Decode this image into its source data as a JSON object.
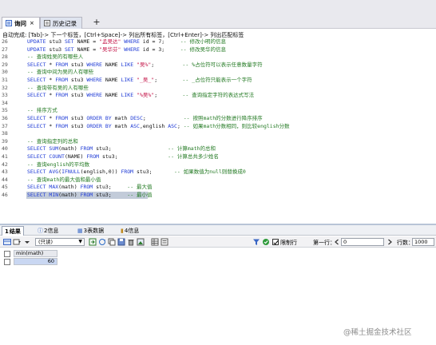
{
  "tabs": [
    {
      "label": "询问",
      "active": true
    },
    {
      "label": "历史记录",
      "active": false
    }
  ],
  "add_tab_label": "+",
  "autocomplete_hint": "自动完成: [Tab]-> 下一个标签，[Ctrl+Space]-> 列出所有标签，[Ctrl+Enter]-> 列出匹配标签",
  "editor_lines": [
    {
      "n": "26",
      "tokens": [
        [
          "kw",
          "UPDATE "
        ],
        [
          "plain",
          "stu3 "
        ],
        [
          "kw",
          "SET "
        ],
        [
          "plain",
          "NAME = "
        ],
        [
          "str",
          "\"孟吴达\""
        ],
        [
          "plain",
          " "
        ],
        [
          "kw",
          "WHERE "
        ],
        [
          "plain",
          "id = 7;     "
        ],
        [
          "com",
          "-- 修改小明的信息"
        ]
      ]
    },
    {
      "n": "27",
      "tokens": [
        [
          "kw",
          "UPDATE "
        ],
        [
          "plain",
          "stu3 "
        ],
        [
          "kw",
          "SET "
        ],
        [
          "plain",
          "NAME = "
        ],
        [
          "str",
          "\"吴华芬\""
        ],
        [
          "plain",
          " "
        ],
        [
          "kw",
          "WHERE "
        ],
        [
          "plain",
          "id = 3;     "
        ],
        [
          "com",
          "-- 修改吴华的信息"
        ]
      ]
    },
    {
      "n": "28",
      "tokens": [
        [
          "com",
          "-- 查询姓吴的有哪些人"
        ]
      ]
    },
    {
      "n": "29",
      "tokens": [
        [
          "kw",
          "SELECT "
        ],
        [
          "plain",
          "* "
        ],
        [
          "kw",
          "FROM "
        ],
        [
          "plain",
          "stu3 "
        ],
        [
          "kw",
          "WHERE "
        ],
        [
          "plain",
          "NAME "
        ],
        [
          "kw",
          "LIKE "
        ],
        [
          "str",
          "\"吴%\""
        ],
        [
          "plain",
          ";         "
        ],
        [
          "com",
          "-- %占位符可以表示任意数量字符"
        ]
      ]
    },
    {
      "n": "30",
      "tokens": [
        [
          "com",
          "-- 查询中间为吴的人有哪些"
        ]
      ]
    },
    {
      "n": "31",
      "tokens": [
        [
          "kw",
          "SELECT "
        ],
        [
          "plain",
          "* "
        ],
        [
          "kw",
          "FROM "
        ],
        [
          "plain",
          "stu3 "
        ],
        [
          "kw",
          "WHERE "
        ],
        [
          "plain",
          "NAME "
        ],
        [
          "kw",
          "LIKE "
        ],
        [
          "str",
          "\"_吴_\""
        ],
        [
          "plain",
          ";        "
        ],
        [
          "com",
          "-- _占位符只能表示一个字符"
        ]
      ]
    },
    {
      "n": "32",
      "tokens": [
        [
          "com",
          "-- 查询带有吴的人有哪些"
        ]
      ]
    },
    {
      "n": "33",
      "tokens": [
        [
          "kw",
          "SELECT "
        ],
        [
          "plain",
          "* "
        ],
        [
          "kw",
          "FROM "
        ],
        [
          "plain",
          "stu3 "
        ],
        [
          "kw",
          "WHERE "
        ],
        [
          "plain",
          "NAME "
        ],
        [
          "kw",
          "LIKE "
        ],
        [
          "str",
          "\"%吴%\""
        ],
        [
          "plain",
          ";        "
        ],
        [
          "com",
          "-- 查询指定字符的表达式写法"
        ]
      ]
    },
    {
      "n": "34",
      "tokens": []
    },
    {
      "n": "35",
      "tokens": [
        [
          "com",
          "-- 排序方式"
        ]
      ]
    },
    {
      "n": "36",
      "tokens": [
        [
          "kw",
          "SELECT "
        ],
        [
          "plain",
          "* "
        ],
        [
          "kw",
          "FROM "
        ],
        [
          "plain",
          "stu3 "
        ],
        [
          "kw",
          "ORDER BY "
        ],
        [
          "plain",
          "math "
        ],
        [
          "kw",
          "DESC"
        ],
        [
          "plain",
          ";            "
        ],
        [
          "com",
          "-- 按照math的分数进行降序排序"
        ]
      ]
    },
    {
      "n": "37",
      "tokens": [
        [
          "kw",
          "SELECT "
        ],
        [
          "plain",
          "* "
        ],
        [
          "kw",
          "FROM "
        ],
        [
          "plain",
          "stu3 "
        ],
        [
          "kw",
          "ORDER BY "
        ],
        [
          "plain",
          "math "
        ],
        [
          "kw",
          "ASC"
        ],
        [
          "plain",
          ",english "
        ],
        [
          "kw",
          "ASC"
        ],
        [
          "plain",
          "; "
        ],
        [
          "com",
          "-- 如果math分数相同，则比较english分数"
        ]
      ]
    },
    {
      "n": "38",
      "tokens": []
    },
    {
      "n": "39",
      "tokens": [
        [
          "com",
          "-- 查询指定列的总和"
        ]
      ]
    },
    {
      "n": "40",
      "tokens": [
        [
          "kw",
          "SELECT "
        ],
        [
          "kw",
          "SUM"
        ],
        [
          "plain",
          "(math) "
        ],
        [
          "kw",
          "FROM "
        ],
        [
          "plain",
          "stu3;                  "
        ],
        [
          "com",
          "-- 计算math的总和"
        ]
      ]
    },
    {
      "n": "41",
      "tokens": [
        [
          "kw",
          "SELECT "
        ],
        [
          "kw",
          "COUNT"
        ],
        [
          "plain",
          "(NAME) "
        ],
        [
          "kw",
          "FROM "
        ],
        [
          "plain",
          "stu3;                "
        ],
        [
          "com",
          "-- 计算总共多少姓名"
        ]
      ]
    },
    {
      "n": "42",
      "tokens": [
        [
          "com",
          "-- 查询english的平均数"
        ]
      ]
    },
    {
      "n": "43",
      "tokens": [
        [
          "kw",
          "SELECT "
        ],
        [
          "kw",
          "AVG"
        ],
        [
          "plain",
          "("
        ],
        [
          "kw",
          "IFNULL"
        ],
        [
          "plain",
          "(english,0)) "
        ],
        [
          "kw",
          "FROM "
        ],
        [
          "plain",
          "stu3;       "
        ],
        [
          "com",
          "-- 如果数值为null则替换成0"
        ]
      ]
    },
    {
      "n": "44",
      "tokens": [
        [
          "com",
          "-- 查询math的最大值和最小值"
        ]
      ]
    },
    {
      "n": "45",
      "tokens": [
        [
          "kw",
          "SELECT "
        ],
        [
          "kw",
          "MAX"
        ],
        [
          "plain",
          "(math) "
        ],
        [
          "kw",
          "FROM "
        ],
        [
          "plain",
          "stu3;     "
        ],
        [
          "com",
          "-- 最大值"
        ]
      ]
    },
    {
      "n": "46",
      "tokens": [
        [
          "kw",
          "SELECT "
        ],
        [
          "kw",
          "MIN"
        ],
        [
          "plain",
          "(math) "
        ],
        [
          "kw",
          "FROM "
        ],
        [
          "plain",
          "stu3;     "
        ],
        [
          "com",
          "-- 最小值"
        ]
      ],
      "selected": true
    }
  ],
  "result_tabs": [
    {
      "num": "1",
      "label": "结果",
      "active": true
    },
    {
      "num": "2",
      "label": "信息",
      "active": false
    },
    {
      "num": "3",
      "label": "表数据",
      "active": false
    },
    {
      "num": "4",
      "label": "信息",
      "active": false
    }
  ],
  "toolbar": {
    "mode_select": "(只读)",
    "limit_label": "限制行",
    "first_row_label": "第一行：",
    "first_row_value": "0",
    "rows_label": "行数：",
    "rows_value": "1000",
    "limit_checked": true
  },
  "result_grid": {
    "columns": [
      "min(math)"
    ],
    "rows": [
      [
        "60"
      ]
    ]
  },
  "watermark": "@稀土掘金技术社区",
  "colors": {
    "keyword": "#1f3bd6",
    "string": "#c4174a",
    "comment": "#237a23",
    "selected_cell": "#c9d7f2"
  }
}
